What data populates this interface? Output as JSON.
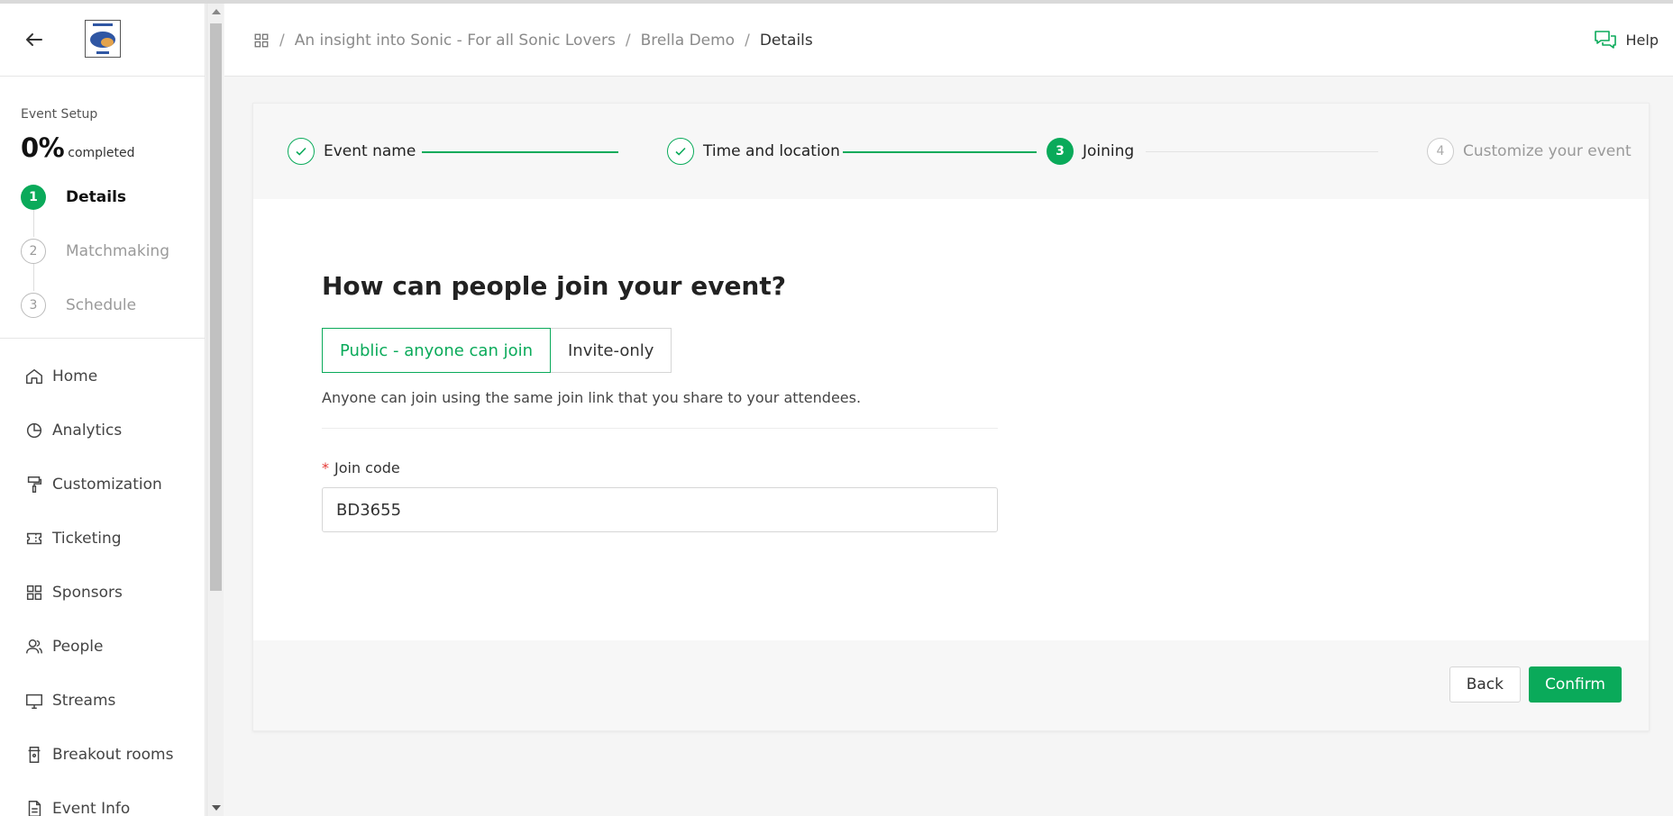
{
  "sidebar": {
    "setup_label": "Event Setup",
    "progress_pct": "0%",
    "progress_suffix": "completed",
    "steps": [
      {
        "num": "1",
        "label": "Details",
        "state": "active"
      },
      {
        "num": "2",
        "label": "Matchmaking",
        "state": "todo"
      },
      {
        "num": "3",
        "label": "Schedule",
        "state": "todo"
      }
    ],
    "nav": [
      {
        "label": "Home",
        "icon": "home-icon"
      },
      {
        "label": "Analytics",
        "icon": "pie-chart-icon"
      },
      {
        "label": "Customization",
        "icon": "paint-roller-icon"
      },
      {
        "label": "Ticketing",
        "icon": "ticket-icon"
      },
      {
        "label": "Sponsors",
        "icon": "grid-icon"
      },
      {
        "label": "People",
        "icon": "people-icon"
      },
      {
        "label": "Streams",
        "icon": "monitor-icon"
      },
      {
        "label": "Breakout rooms",
        "icon": "door-icon"
      },
      {
        "label": "Event Info",
        "icon": "document-icon"
      }
    ]
  },
  "header": {
    "breadcrumbs": [
      "An insight into Sonic - For all Sonic Lovers",
      "Brella Demo",
      "Details"
    ],
    "help_label": "Help"
  },
  "wizard": {
    "steps": [
      {
        "num": "1",
        "label": "Event name",
        "state": "done"
      },
      {
        "num": "2",
        "label": "Time and location",
        "state": "done"
      },
      {
        "num": "3",
        "label": "Joining",
        "state": "active"
      },
      {
        "num": "4",
        "label": "Customize your event",
        "state": "todo"
      }
    ]
  },
  "joining": {
    "title": "How can people join your event?",
    "option_public": "Public - anyone can join",
    "option_invite": "Invite-only",
    "description": "Anyone can join using the same join link that you share to your attendees.",
    "join_code_label": "Join code",
    "required_mark": "*",
    "join_code_value": "BD3655"
  },
  "footer": {
    "back_label": "Back",
    "confirm_label": "Confirm"
  },
  "colors": {
    "accent": "#0aaa5a",
    "required": "#e53935"
  }
}
